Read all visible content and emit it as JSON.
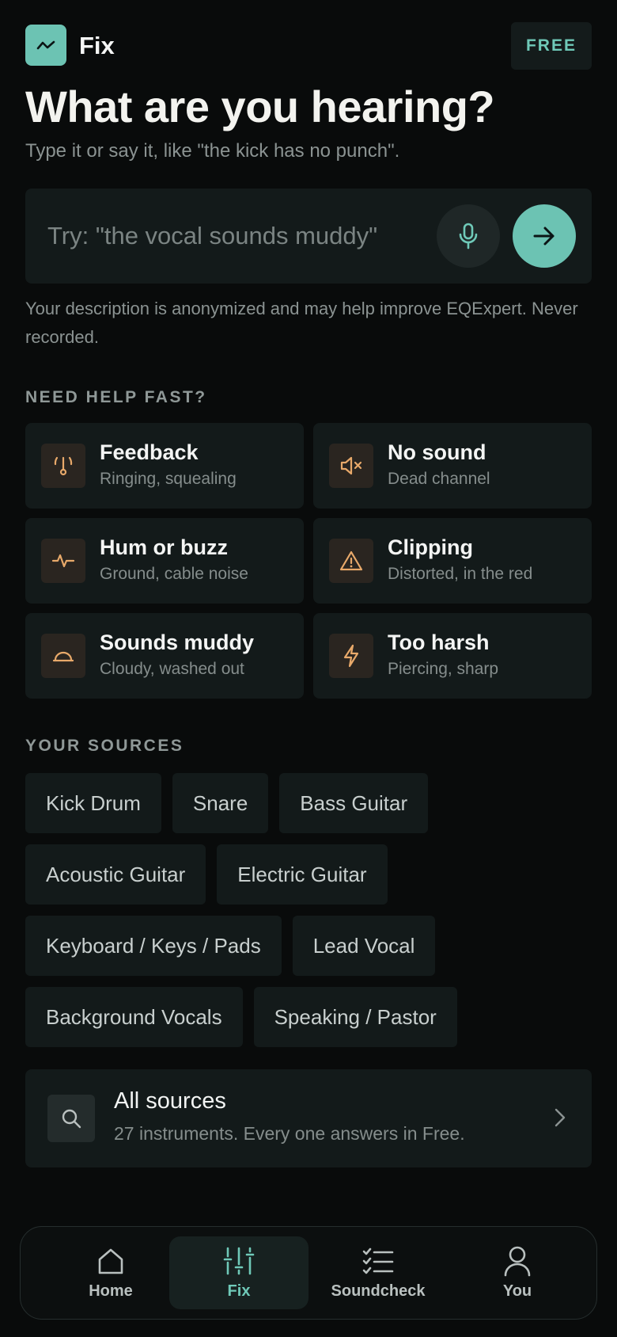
{
  "header": {
    "app_name": "Fix",
    "plan_badge": "FREE",
    "logo_icon": "waveform-icon"
  },
  "hero": {
    "title": "What are you hearing?",
    "subtitle": "Type it or say it, like \"the kick has no punch\"."
  },
  "search": {
    "value": "",
    "placeholder": "Try: \"the vocal sounds muddy\"",
    "mic_icon": "microphone-icon",
    "submit_icon": "arrow-right-icon",
    "note": "Your description is anonymized and may help improve EQExpert. Never recorded."
  },
  "quick_help": {
    "label": "NEED HELP FAST?",
    "items": [
      {
        "title": "Feedback",
        "subtitle": "Ringing, squealing",
        "icon": "feedback-icon"
      },
      {
        "title": "No sound",
        "subtitle": "Dead channel",
        "icon": "speaker-muted-icon"
      },
      {
        "title": "Hum or buzz",
        "subtitle": "Ground, cable noise",
        "icon": "pulse-icon"
      },
      {
        "title": "Clipping",
        "subtitle": "Distorted, in the red",
        "icon": "warning-icon"
      },
      {
        "title": "Sounds muddy",
        "subtitle": "Cloudy, washed out",
        "icon": "dome-icon"
      },
      {
        "title": "Too harsh",
        "subtitle": "Piercing, sharp",
        "icon": "lightning-icon"
      }
    ]
  },
  "sources": {
    "label": "YOUR SOURCES",
    "chips": [
      "Kick Drum",
      "Snare",
      "Bass Guitar",
      "Acoustic Guitar",
      "Electric Guitar",
      "Keyboard / Keys / Pads",
      "Lead Vocal",
      "Background Vocals",
      "Speaking / Pastor"
    ],
    "all": {
      "title": "All sources",
      "subtitle": "27 instruments. Every one answers in Free.",
      "icon": "search-icon"
    }
  },
  "nav": {
    "items": [
      {
        "label": "Home",
        "icon": "home-icon",
        "active": false
      },
      {
        "label": "Fix",
        "icon": "sliders-icon",
        "active": true
      },
      {
        "label": "Soundcheck",
        "icon": "checklist-icon",
        "active": false
      },
      {
        "label": "You",
        "icon": "user-icon",
        "active": false
      }
    ]
  },
  "colors": {
    "background": "#090b0b",
    "surface": "#131a1a",
    "accent": "#6cc3b3",
    "warning_icon": "#e8a96a"
  }
}
